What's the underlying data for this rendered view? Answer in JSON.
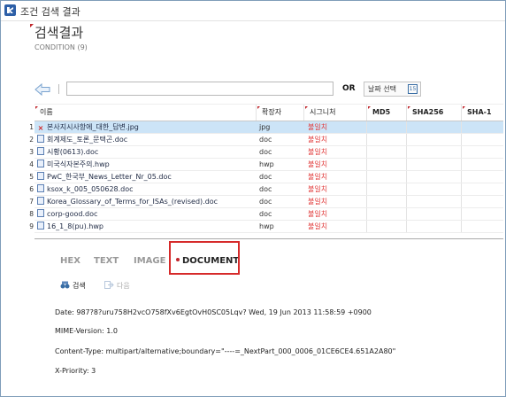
{
  "window": {
    "title": "조건 검색 결과"
  },
  "page": {
    "title": "검색결과",
    "subtitle": "CONDITION (9)"
  },
  "toolbar": {
    "search_value": "",
    "or_label": "OR",
    "date_button": "날짜 선택",
    "calendar_number": "15"
  },
  "grid": {
    "columns": [
      "이름",
      "확장자",
      "시그니처",
      "MD5",
      "SHA256",
      "SHA-1"
    ],
    "rows": [
      {
        "num": "1",
        "name": "본사지시사항에_대한_답변.jpg",
        "ext": "jpg",
        "sig": "불일치",
        "icon": "error-icon",
        "selected": true
      },
      {
        "num": "2",
        "name": "회계제도_토론_문택곤.doc",
        "ext": "doc",
        "sig": "불일치",
        "icon": "doc-file-icon"
      },
      {
        "num": "3",
        "name": "시황(0613).doc",
        "ext": "doc",
        "sig": "불일치",
        "icon": "doc-file-icon"
      },
      {
        "num": "4",
        "name": "미국식자본주의.hwp",
        "ext": "hwp",
        "sig": "불일치",
        "icon": "hwp-file-icon"
      },
      {
        "num": "5",
        "name": "PwC_한국부_News_Letter_Nr_05.doc",
        "ext": "doc",
        "sig": "불일치",
        "icon": "doc-file-icon"
      },
      {
        "num": "6",
        "name": "ksox_k_005_050628.doc",
        "ext": "doc",
        "sig": "불일치",
        "icon": "doc-file-icon"
      },
      {
        "num": "7",
        "name": "Korea_Glossary_of_Terms_for_ISAs_(revised).doc",
        "ext": "doc",
        "sig": "불일치",
        "icon": "doc-file-icon"
      },
      {
        "num": "8",
        "name": "corp-good.doc",
        "ext": "doc",
        "sig": "불일치",
        "icon": "doc-file-icon"
      },
      {
        "num": "9",
        "name": "16_1_8(pu).hwp",
        "ext": "hwp",
        "sig": "불일치",
        "icon": "hwp-file-icon"
      }
    ]
  },
  "tabs": [
    "HEX",
    "TEXT",
    "IMAGE",
    "DOCUMENT"
  ],
  "active_tab": "DOCUMENT",
  "subtoolbar": {
    "search": "검색",
    "next": "다음"
  },
  "document": {
    "lines": [
      "Date: 987?8?uru758H2vcO758fXv6EgtOvH0SC05Lqv? Wed, 19 Jun 2013 11:58:59 +0900",
      "MIME-Version: 1.0",
      "Content-Type: multipart/alternative;boundary=\"----=_NextPart_000_0006_01CE6CE4.651A2A80\"",
      "X-Priority: 3"
    ]
  },
  "colors": {
    "accent_red": "#c0262c",
    "mismatch_red": "#e23c3c",
    "selection": "#cce4f7"
  }
}
